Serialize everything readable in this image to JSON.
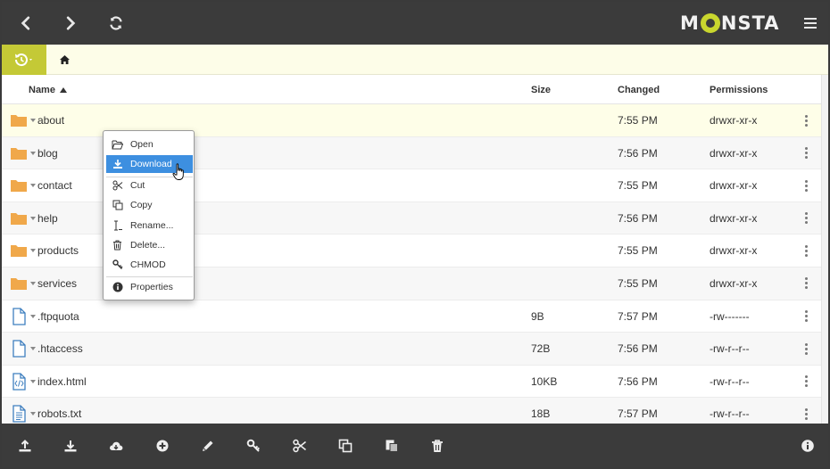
{
  "app": {
    "logo": "MONSTA",
    "accent": "#c9d62e",
    "bar_color": "#3b3b3b",
    "selection_color": "#3d8fe0"
  },
  "topbar": {
    "buttons": [
      {
        "name": "back-button",
        "icon": "chevron-left-icon"
      },
      {
        "name": "forward-button",
        "icon": "chevron-right-icon"
      },
      {
        "name": "refresh-button",
        "icon": "refresh-icon"
      },
      {
        "name": "menu-button",
        "icon": "hamburger-icon"
      }
    ]
  },
  "breadcrumb": {
    "history_icon": "history-icon",
    "home_icon": "home-icon"
  },
  "table": {
    "columns": {
      "name": "Name",
      "size": "Size",
      "changed": "Changed",
      "permissions": "Permissions"
    },
    "sort_icon": "sort-up-icon",
    "rows": [
      {
        "type": "folder",
        "name": "about",
        "size": "",
        "changed": "7:55 PM",
        "permissions": "drwxr-xr-x"
      },
      {
        "type": "folder",
        "name": "blog",
        "size": "",
        "changed": "7:56 PM",
        "permissions": "drwxr-xr-x"
      },
      {
        "type": "folder",
        "name": "contact",
        "size": "",
        "changed": "7:55 PM",
        "permissions": "drwxr-xr-x"
      },
      {
        "type": "folder",
        "name": "help",
        "size": "",
        "changed": "7:56 PM",
        "permissions": "drwxr-xr-x"
      },
      {
        "type": "folder",
        "name": "products",
        "size": "",
        "changed": "7:55 PM",
        "permissions": "drwxr-xr-x"
      },
      {
        "type": "folder",
        "name": "services",
        "size": "",
        "changed": "7:55 PM",
        "permissions": "drwxr-xr-x"
      },
      {
        "type": "file",
        "name": ".ftpquota",
        "size": "9B",
        "changed": "7:57 PM",
        "permissions": "-rw-------"
      },
      {
        "type": "file",
        "name": ".htaccess",
        "size": "72B",
        "changed": "7:56 PM",
        "permissions": "-rw-r--r--"
      },
      {
        "type": "code",
        "name": "index.html",
        "size": "10KB",
        "changed": "7:56 PM",
        "permissions": "-rw-r--r--"
      },
      {
        "type": "text",
        "name": "robots.txt",
        "size": "18B",
        "changed": "7:57 PM",
        "permissions": "-rw-r--r--"
      }
    ]
  },
  "context_menu": {
    "items": [
      {
        "label": "Open",
        "icon": "folder-open-icon"
      },
      {
        "label": "Download",
        "icon": "download-icon",
        "highlighted": true
      },
      {
        "label": "Cut",
        "icon": "scissors-icon"
      },
      {
        "label": "Copy",
        "icon": "copy-icon"
      },
      {
        "label": "Rename...",
        "icon": "text-cursor-icon"
      },
      {
        "label": "Delete...",
        "icon": "trash-icon"
      },
      {
        "label": "CHMOD",
        "icon": "key-icon"
      },
      {
        "label": "Properties",
        "icon": "info-icon"
      }
    ]
  },
  "bottombar": {
    "buttons": [
      {
        "name": "upload-button",
        "icon": "upload-icon"
      },
      {
        "name": "download-button",
        "icon": "download-icon"
      },
      {
        "name": "cloud-download-button",
        "icon": "cloud-download-icon"
      },
      {
        "name": "new-item-button",
        "icon": "plus-circle-icon"
      },
      {
        "name": "edit-button",
        "icon": "pencil-icon"
      },
      {
        "name": "chmod-button",
        "icon": "key-icon"
      },
      {
        "name": "cut-button",
        "icon": "scissors-icon"
      },
      {
        "name": "copy-button",
        "icon": "copy-icon"
      },
      {
        "name": "paste-button",
        "icon": "paste-icon"
      },
      {
        "name": "delete-button",
        "icon": "trash-icon"
      },
      {
        "name": "info-button",
        "icon": "info-icon"
      }
    ]
  }
}
